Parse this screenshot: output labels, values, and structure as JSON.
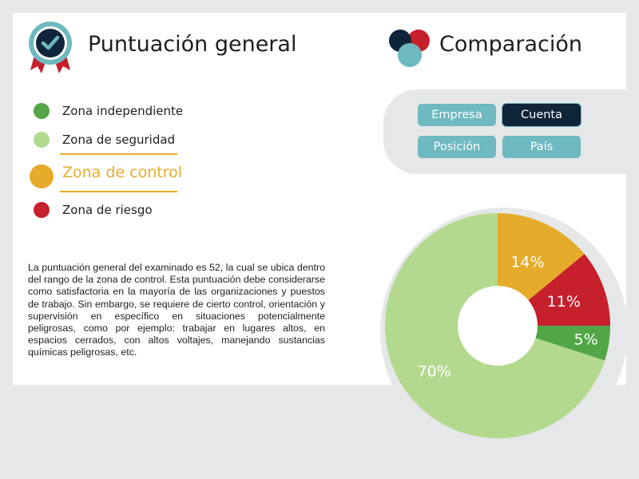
{
  "header": {
    "score_title": "Puntuación general",
    "compare_title": "Comparación"
  },
  "legend": [
    {
      "label": "Zona independiente",
      "color": "#52a646",
      "active": false
    },
    {
      "label": "Zona de seguridad",
      "color": "#b3d98e",
      "active": false
    },
    {
      "label": "Zona de control",
      "color": "#e6ab2a",
      "active": true
    },
    {
      "label": "Zona de riesgo",
      "color": "#c5202c",
      "active": false
    }
  ],
  "description": "La puntuación general del examinado es 52, la cual se ubica dentro del rango de la zona de control. Esta puntuación debe considerarse como satisfactoria en la mayoría de las organizaciones y puestos de trabajo. Sin embargo, se requiere de cierto control, orientación y supervisión en específico en situaciones potencialmente peligrosas, como por ejemplo: trabajar en lugares altos, en espacios cerrados, con altos voltajes, manejando sustancias químicas peligrosas, etc.",
  "comparison": {
    "buttons": [
      {
        "label": "Empresa",
        "selected": false
      },
      {
        "label": "Cuenta",
        "selected": true
      },
      {
        "label": "Posición",
        "selected": false
      },
      {
        "label": "País",
        "selected": false
      }
    ],
    "colors": {
      "default": "#6fb9c0",
      "selected": "#10243a"
    }
  },
  "chart_data": {
    "type": "pie",
    "donut": true,
    "slices": [
      {
        "label": "14%",
        "value": 14,
        "color": "#e6ab2a"
      },
      {
        "label": "11%",
        "value": 11,
        "color": "#c5202c"
      },
      {
        "label": "5%",
        "value": 5,
        "color": "#52a646"
      },
      {
        "label": "70%",
        "value": 70,
        "color": "#b3d98e"
      }
    ]
  }
}
